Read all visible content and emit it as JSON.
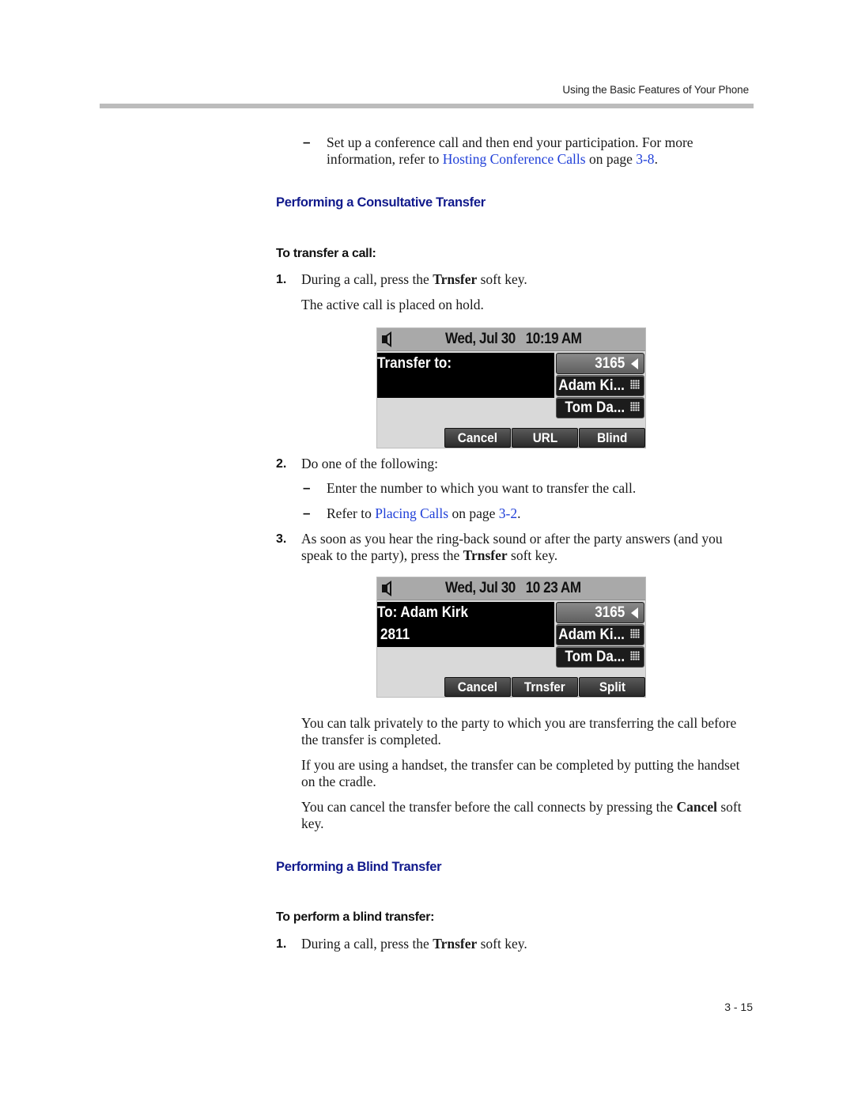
{
  "header": {
    "running_head": "Using the Basic Features of Your Phone"
  },
  "intro_bullet": {
    "text_before": "Set up a conference call and then end your participation. For more information, refer to ",
    "link_text": "Hosting Conference Calls",
    "text_mid": " on page ",
    "page_link": "3-8",
    "text_after": "."
  },
  "consultative": {
    "section_title": "Performing a Consultative Transfer",
    "procedure_title": "To transfer a call:",
    "step1": {
      "number": "1.",
      "text_before": "During a call, press the ",
      "bold": "Trnsfer",
      "text_after": " soft key.",
      "note": "The active call is placed on hold."
    },
    "screen1": {
      "date": "Wed, Jul 30   10:19 AM",
      "line1": "Transfer to:",
      "line2": "",
      "line_keys": [
        {
          "label": "3165",
          "icon": "speaker-left-icon",
          "active": true
        },
        {
          "label": "Adam Ki...",
          "icon": "keypad-icon",
          "active": false
        },
        {
          "label": "Tom Da...",
          "icon": "keypad-icon",
          "active": false
        }
      ],
      "soft_keys": [
        "Cancel",
        "URL",
        "Blind"
      ]
    },
    "step2": {
      "number": "2.",
      "text": "Do one of the following:",
      "bullets": [
        {
          "text": "Enter the number to which you want to transfer the call."
        },
        {
          "text_before": "Refer to ",
          "link_text": "Placing Calls",
          "text_mid": " on page ",
          "page_link": "3-2",
          "text_after": "."
        }
      ]
    },
    "step3": {
      "number": "3.",
      "text_before": "As soon as you hear the ring-back sound or after the party answers (and you speak to the party), press the ",
      "bold": "Trnsfer",
      "text_after": " soft key."
    },
    "screen2": {
      "date": "Wed, Jul 30   10 23 AM",
      "line1": "To: Adam Kirk",
      "line2": "2811",
      "line_keys": [
        {
          "label": "3165",
          "icon": "speaker-left-icon",
          "active": true
        },
        {
          "label": "Adam Ki...",
          "icon": "keypad-icon",
          "active": false
        },
        {
          "label": "Tom Da...",
          "icon": "keypad-icon",
          "active": false
        }
      ],
      "soft_keys": [
        "Cancel",
        "Trnsfer",
        "Split"
      ]
    },
    "notes": [
      "You can talk privately to the party to which you are transferring the call before the transfer is completed.",
      "If you are using a handset, the transfer can be completed by putting the handset on the cradle."
    ],
    "cancel_note": {
      "text_before": "You can cancel the transfer before the call connects by pressing the ",
      "bold": "Cancel",
      "text_after": " soft key."
    }
  },
  "blind": {
    "section_title": "Performing a Blind Transfer",
    "procedure_title": "To perform a blind transfer:",
    "step1": {
      "number": "1.",
      "text_before": "During a call, press the ",
      "bold": "Trnsfer",
      "text_after": " soft key."
    }
  },
  "footer": {
    "page_number": "3 - 15"
  },
  "colors": {
    "link": "#1f3fd8",
    "section_heading": "#111a8c",
    "rule": "#bcbcbc"
  }
}
